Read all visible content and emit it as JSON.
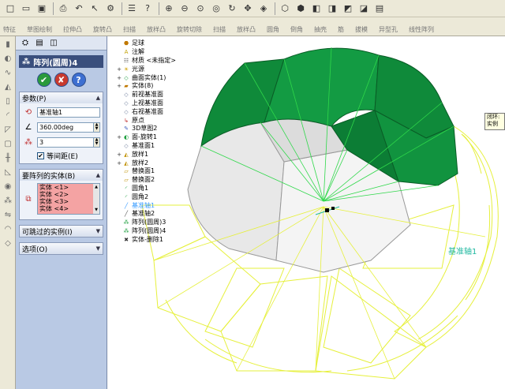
{
  "toolbar": {
    "row2_labels": [
      "特征",
      "草图绘制",
      "拉伸凸",
      "旋转凸",
      "扫描",
      "放样凸",
      "旋转切除",
      "扫描",
      "放样凸",
      "圆角",
      "倒角",
      "抽壳",
      "筋",
      "拔模",
      "异型孔",
      "线性阵列"
    ]
  },
  "panel": {
    "feature_title": "阵列(圆周)4",
    "ok_symbol": "✔",
    "cancel_symbol": "✘",
    "help_symbol": "?",
    "params": {
      "header": "参数(P)",
      "axis_value": "基准轴1",
      "angle_value": "360.00deg",
      "count_value": "3",
      "equal_spacing_label": "等间距(E)",
      "equal_spacing_checked": true
    },
    "bodies": {
      "header": "要阵列的实体(B)",
      "items": [
        "实体 <1>",
        "实体 <2>",
        "实体 <3>",
        "实体 <4>"
      ]
    },
    "skip_header": "可跳过的实例(I)",
    "options_header": "选项(O)"
  },
  "tree": {
    "items": [
      {
        "label": "足球",
        "expand": "",
        "icon": "part"
      },
      {
        "label": "注解",
        "expand": "",
        "icon": "annot"
      },
      {
        "label": "材质 <未指定>",
        "expand": "",
        "icon": "material"
      },
      {
        "label": "光源",
        "expand": "+",
        "icon": "light"
      },
      {
        "label": "曲面实体(1)",
        "expand": "+",
        "icon": "surface"
      },
      {
        "label": "实体(8)",
        "expand": "+",
        "icon": "solid"
      },
      {
        "label": "前视基准面",
        "expand": "",
        "icon": "plane"
      },
      {
        "label": "上视基准面",
        "expand": "",
        "icon": "plane"
      },
      {
        "label": "右视基准面",
        "expand": "",
        "icon": "plane"
      },
      {
        "label": "原点",
        "expand": "",
        "icon": "origin"
      },
      {
        "label": "3D草图2",
        "expand": "",
        "icon": "sketch"
      },
      {
        "label": "面-旋转1",
        "expand": "+",
        "icon": "revolve"
      },
      {
        "label": "基准面1",
        "expand": "",
        "icon": "plane"
      },
      {
        "label": "放样1",
        "expand": "+",
        "icon": "loft"
      },
      {
        "label": "放样2",
        "expand": "+",
        "icon": "loft"
      },
      {
        "label": "替换面1",
        "expand": "",
        "icon": "replace"
      },
      {
        "label": "替换面2",
        "expand": "",
        "icon": "replace"
      },
      {
        "label": "圆角1",
        "expand": "",
        "icon": "fillet"
      },
      {
        "label": "圆角2",
        "expand": "",
        "icon": "fillet"
      },
      {
        "label": "基准轴1",
        "expand": "",
        "icon": "axis",
        "highlight": true
      },
      {
        "label": "基准轴2",
        "expand": "",
        "icon": "axis"
      },
      {
        "label": "阵列(圆周)3",
        "expand": "",
        "icon": "pattern"
      },
      {
        "label": "阵列(圆周)4",
        "expand": "",
        "icon": "pattern"
      },
      {
        "label": "实体-删除1",
        "expand": "",
        "icon": "delete"
      }
    ]
  },
  "viewport": {
    "axis_label": "基准轴1",
    "tooltip_line1": "闭环:",
    "tooltip_line2": "实例"
  },
  "colors": {
    "green_face": "#0f8a3a",
    "wire_yellow": "#e6f03c",
    "wire_green": "#2fd84a",
    "panel_bg": "#b9c9e4",
    "axis_label": "#1fb8a0",
    "body_list": "#f4a3a3"
  }
}
